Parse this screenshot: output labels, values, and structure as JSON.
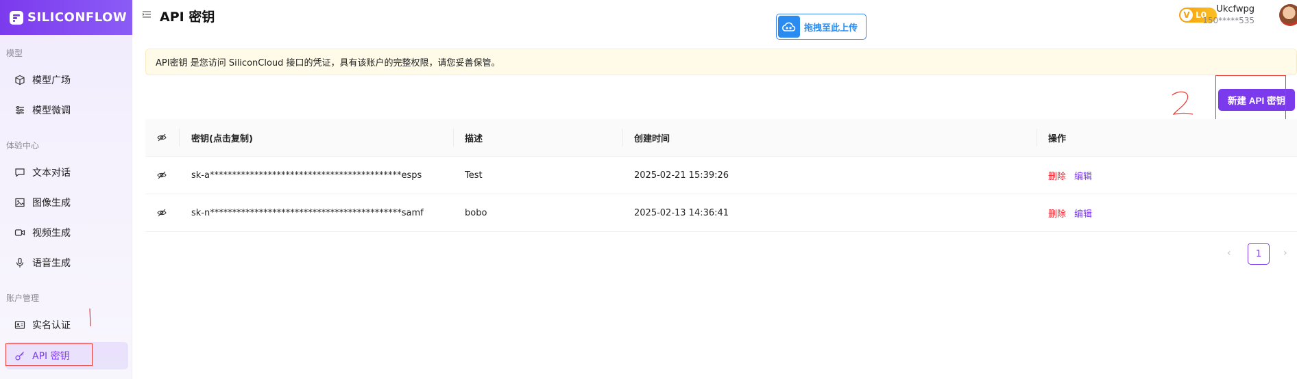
{
  "app": {
    "logo_text": "SILICONFLOW",
    "brand_color": "#7c3aed"
  },
  "sidebar": {
    "sections": [
      {
        "title": "模型",
        "items": [
          {
            "label": "模型广场",
            "icon": "cube-icon"
          },
          {
            "label": "模型微调",
            "icon": "sliders-icon"
          }
        ]
      },
      {
        "title": "体验中心",
        "items": [
          {
            "label": "文本对话",
            "icon": "chat-icon"
          },
          {
            "label": "图像生成",
            "icon": "image-icon"
          },
          {
            "label": "视频生成",
            "icon": "video-icon"
          },
          {
            "label": "语音生成",
            "icon": "mic-icon"
          }
        ]
      },
      {
        "title": "账户管理",
        "items": [
          {
            "label": "实名认证",
            "icon": "id-card-icon"
          },
          {
            "label": "API 密钥",
            "icon": "key-icon",
            "active": true
          }
        ]
      }
    ]
  },
  "header": {
    "title": "API 密钥",
    "upload_label": "拖拽至此上传",
    "level": "L0",
    "level_letter": "V",
    "user_name": "Ukcfwpg",
    "user_phone": "150*****535"
  },
  "notice": "API密钥 是您访问 SiliconCloud 接口的凭证，具有该账户的完整权限，请您妥善保管。",
  "create_button": "新建 API 密钥",
  "annotations": {
    "two": "2",
    "one": "1"
  },
  "table": {
    "headers": {
      "key": "密钥(点击复制)",
      "desc": "描述",
      "time": "创建时间",
      "ops": "操作"
    },
    "rows": [
      {
        "key": "sk-a*******************************************esps",
        "desc": "Test",
        "time": "2025-02-21 15:39:26",
        "delete": "删除",
        "edit": "编辑"
      },
      {
        "key": "sk-n*******************************************samf",
        "desc": "bobo",
        "time": "2025-02-13 14:36:41",
        "delete": "删除",
        "edit": "编辑"
      }
    ]
  },
  "pagination": {
    "current": "1",
    "prev": "‹",
    "next": "›"
  }
}
